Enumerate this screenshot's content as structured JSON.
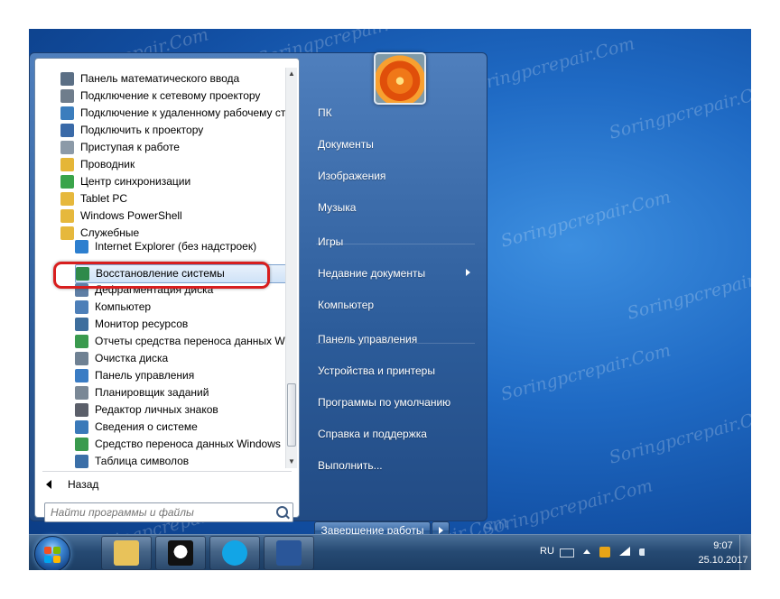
{
  "program_list": [
    {
      "label": "Панель математического ввода",
      "icon": "math-input-icon",
      "color": "#5b6f85"
    },
    {
      "label": "Подключение к сетевому проектору",
      "icon": "network-projector-icon",
      "color": "#6f7d8c"
    },
    {
      "label": "Подключение к удаленному рабочему столу",
      "icon": "remote-desktop-icon",
      "color": "#3b7dbd"
    },
    {
      "label": "Подключить к проектору",
      "icon": "projector-icon",
      "color": "#3a6aa8"
    },
    {
      "label": "Приступая к работе",
      "icon": "getting-started-icon",
      "color": "#8c9aa8"
    },
    {
      "label": "Проводник",
      "icon": "explorer-folder-icon",
      "color": "#e5b637"
    },
    {
      "label": "Центр синхронизации",
      "icon": "sync-center-icon",
      "color": "#3aa44a"
    },
    {
      "label": "Tablet PC",
      "icon": "folder-icon",
      "color": "#e6b83c"
    },
    {
      "label": "Windows PowerShell",
      "icon": "folder-icon",
      "color": "#e6b83c"
    },
    {
      "label": "Служебные",
      "icon": "folder-open-icon",
      "color": "#e6b83c"
    }
  ],
  "sub_list": [
    {
      "label": "Internet Explorer (без надстроек)",
      "icon": "internet-explorer-icon",
      "color": "#2d7fcf"
    },
    {
      "label": "Восстановление системы",
      "icon": "system-restore-icon",
      "color": "#2f8a4a",
      "highlight": true
    },
    {
      "label": "Дефрагментация диска",
      "icon": "defrag-icon",
      "color": "#5f7fa5"
    },
    {
      "label": "Компьютер",
      "icon": "computer-icon",
      "color": "#4d7fb8"
    },
    {
      "label": "Монитор ресурсов",
      "icon": "resource-monitor-icon",
      "color": "#3e6e9d"
    },
    {
      "label": "Отчеты средства переноса данных Windows",
      "icon": "transfer-reports-icon",
      "color": "#3a9a4e"
    },
    {
      "label": "Очистка диска",
      "icon": "disk-cleanup-icon",
      "color": "#6f8193"
    },
    {
      "label": "Панель управления",
      "icon": "control-panel-icon",
      "color": "#3a7cc4"
    },
    {
      "label": "Планировщик заданий",
      "icon": "task-scheduler-icon",
      "color": "#7a8896"
    },
    {
      "label": "Редактор личных знаков",
      "icon": "char-editor-icon",
      "color": "#5b5f6a"
    },
    {
      "label": "Сведения о системе",
      "icon": "system-info-icon",
      "color": "#3a79b9"
    },
    {
      "label": "Средство переноса данных Windows",
      "icon": "easy-transfer-icon",
      "color": "#3a9a4e"
    },
    {
      "label": "Таблица символов",
      "icon": "charmap-icon",
      "color": "#3b6fa8"
    }
  ],
  "back_label": "Назад",
  "search_placeholder": "Найти программы и файлы",
  "right_items": [
    {
      "label": "ПК"
    },
    {
      "label": "Документы"
    },
    {
      "label": "Изображения"
    },
    {
      "label": "Музыка"
    },
    {
      "label": "Игры"
    },
    {
      "label": "Недавние документы",
      "submenu": true
    },
    {
      "label": "Компьютер"
    },
    {
      "label": "Панель управления"
    },
    {
      "label": "Устройства и принтеры"
    },
    {
      "label": "Программы по умолчанию"
    },
    {
      "label": "Справка и поддержка"
    },
    {
      "label": "Выполнить..."
    }
  ],
  "shutdown_label": "Завершение работы",
  "taskbar": {
    "apps": [
      {
        "name": "explorer-taskbar-button",
        "icon": "folder-library-icon",
        "color": "#e8c25a"
      },
      {
        "name": "panda-taskbar-button",
        "icon": "panda-antivirus-icon",
        "color": "#222222"
      },
      {
        "name": "skype-taskbar-button",
        "icon": "skype-icon",
        "color": "#12a5e6"
      },
      {
        "name": "word-taskbar-button",
        "icon": "word-icon",
        "color": "#2a5699"
      }
    ],
    "language": "RU",
    "time": "9:07",
    "date": "25.10.2017"
  },
  "watermark_text": "Soringpcrepair.Com",
  "colors": {
    "highlight_ring": "#d81e1e",
    "desktop_blue": "#1f6ac4"
  }
}
